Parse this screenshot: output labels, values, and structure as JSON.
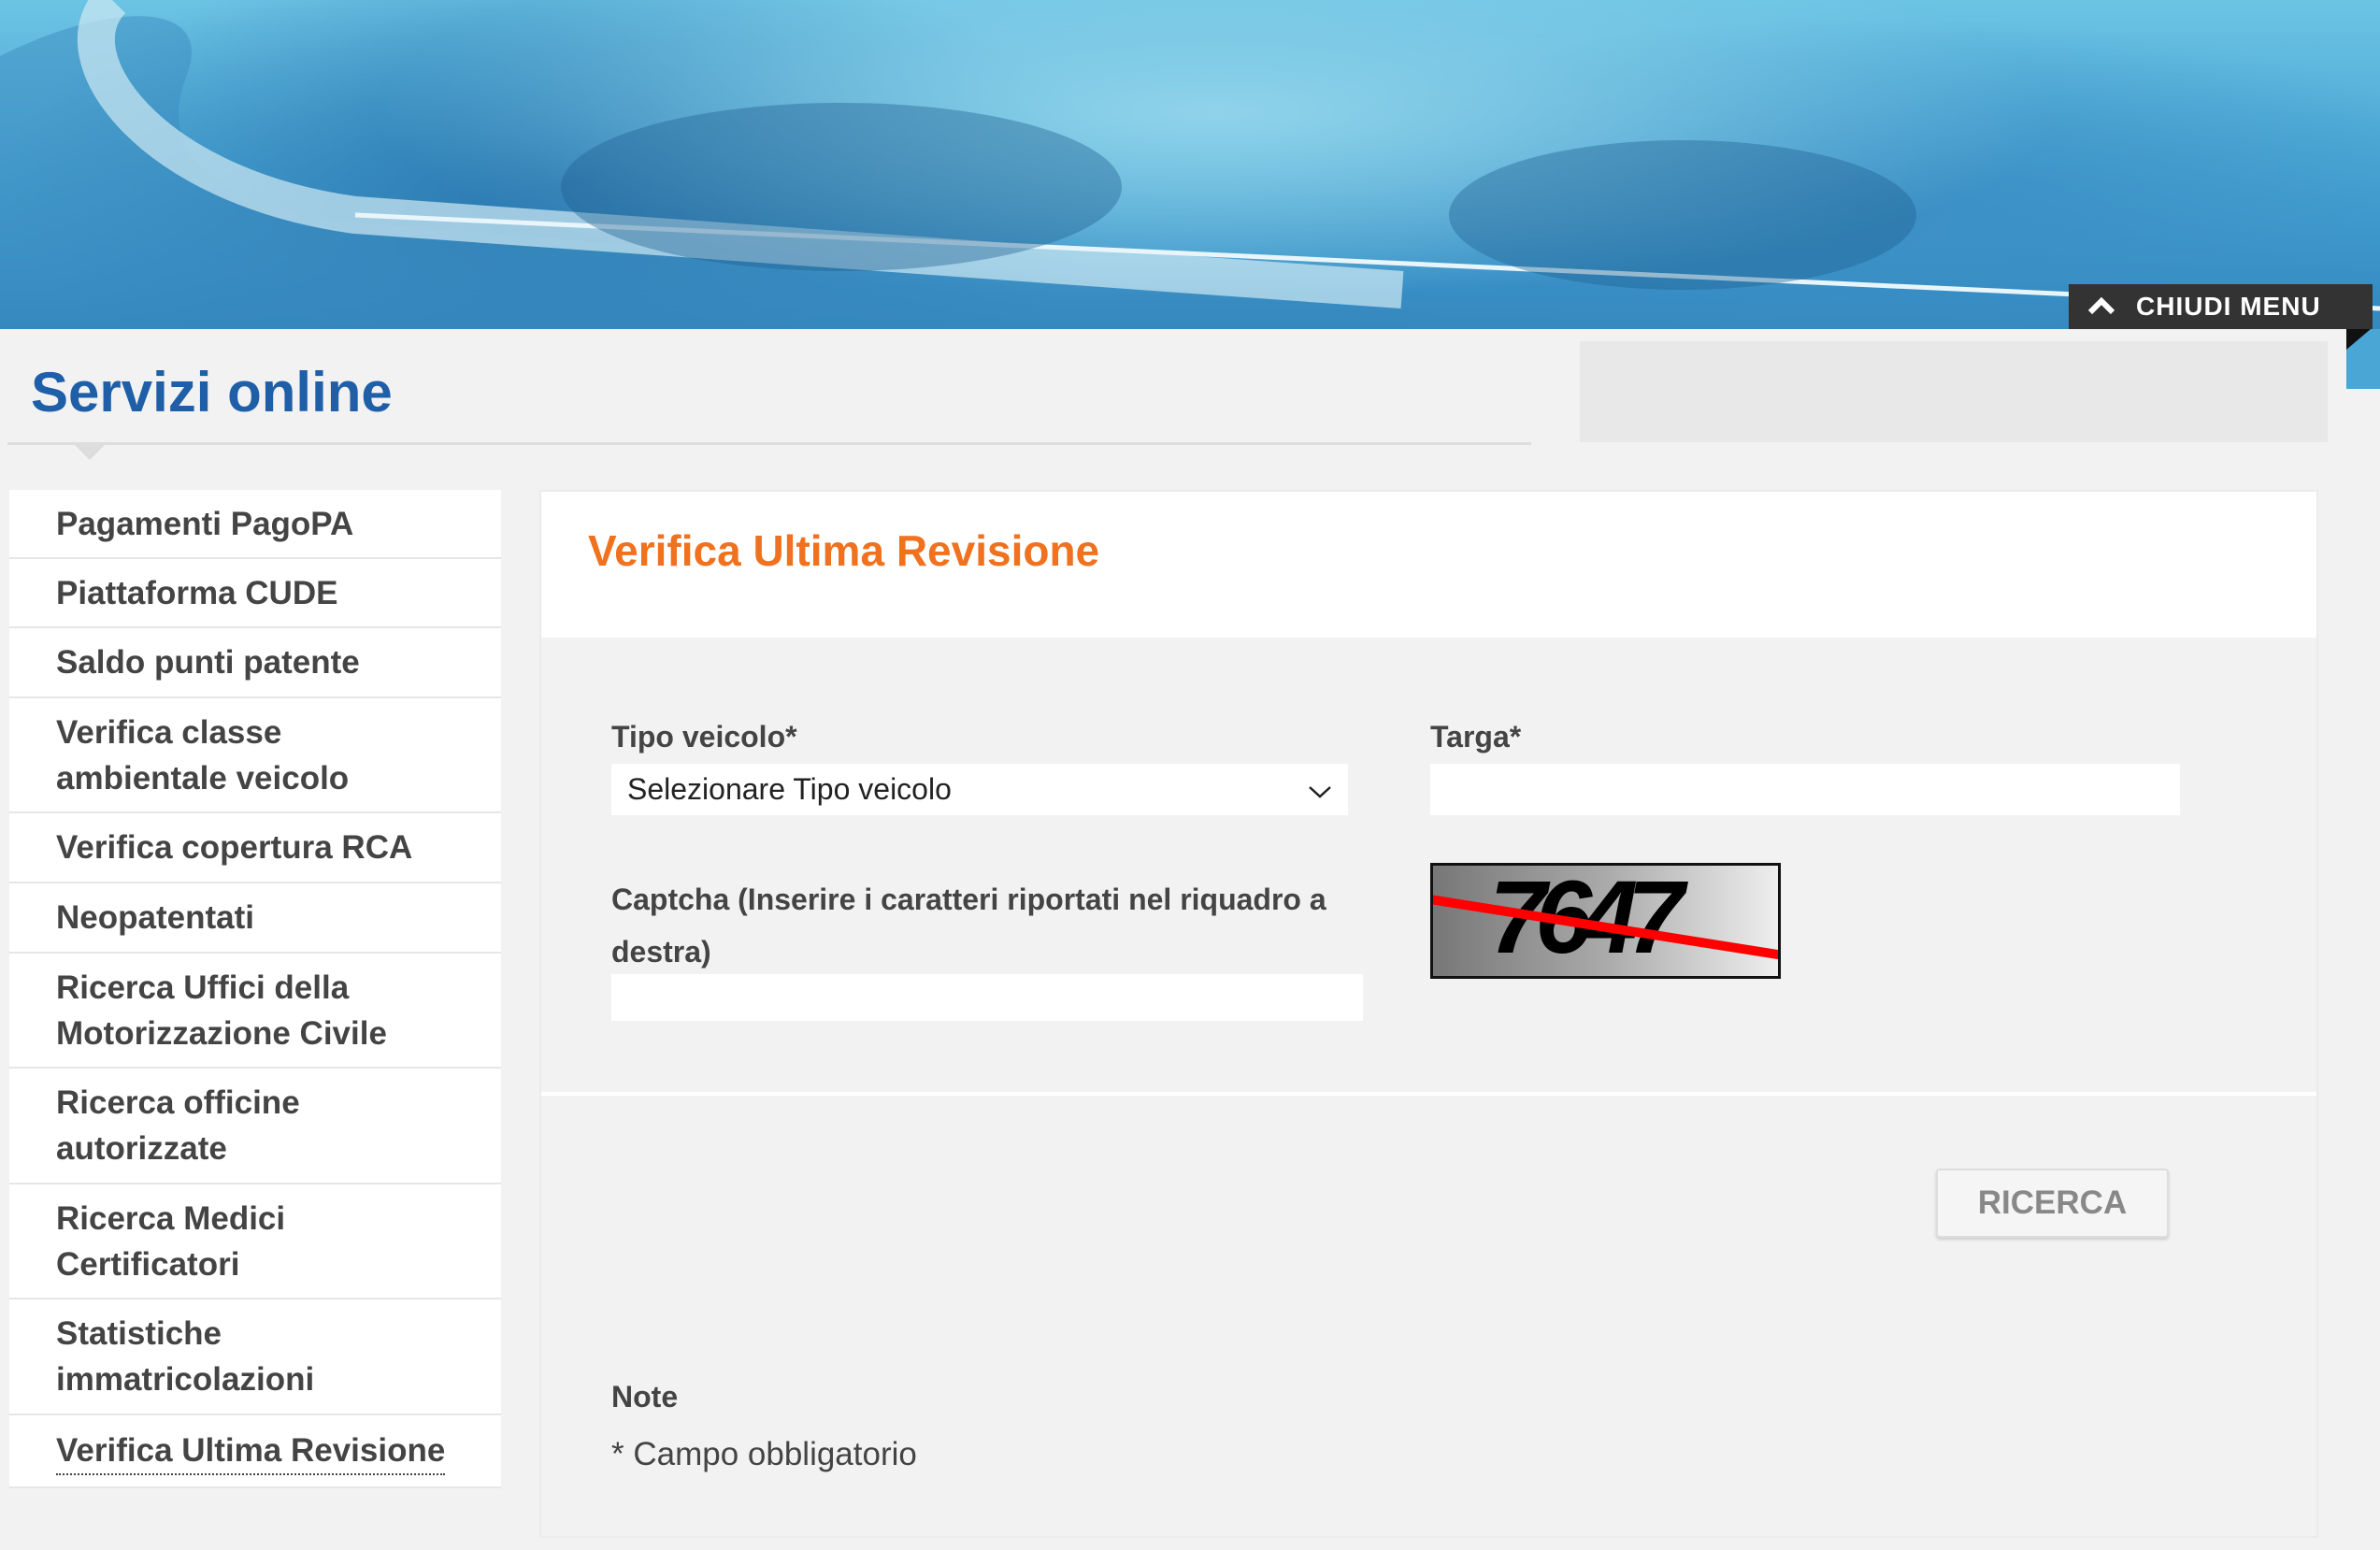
{
  "header": {
    "close_menu_label": "CHIUDI MENU",
    "page_title": "Servizi online"
  },
  "sidebar": {
    "items": [
      {
        "label": "Pagamenti PagoPA"
      },
      {
        "label": "Piattaforma CUDE"
      },
      {
        "label": "Saldo punti patente"
      },
      {
        "label": "Verifica classe ambientale veicolo"
      },
      {
        "label": "Verifica copertura RCA"
      },
      {
        "label": "Neopatentati"
      },
      {
        "label": "Ricerca Uffici della Motorizzazione Civile"
      },
      {
        "label": "Ricerca officine autorizzate"
      },
      {
        "label": "Ricerca Medici Certificatori"
      },
      {
        "label": "Statistiche immatricolazioni"
      },
      {
        "label": "Verifica Ultima Revisione"
      }
    ]
  },
  "form": {
    "title": "Verifica Ultima Revisione",
    "vehicle_type_label": "Tipo veicolo*",
    "vehicle_type_value": "Selezionare Tipo veicolo",
    "plate_label": "Targa*",
    "plate_value": "",
    "captcha_label": "Captcha (Inserire i caratteri riportati nel riquadro a destra)",
    "captcha_value": "",
    "captcha_image_text": "7647",
    "search_button": "RICERCA",
    "note_title": "Note",
    "note_text": "* Campo obbligatorio"
  },
  "colors": {
    "title_blue": "#1e5fa8",
    "accent_orange": "#f0711e"
  }
}
